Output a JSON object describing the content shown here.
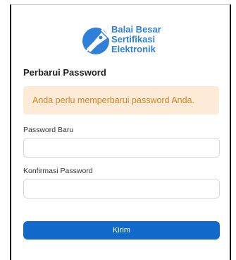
{
  "brand": {
    "lines": [
      "Balai Besar",
      "Sertifikasi",
      "Elektronik"
    ],
    "color": "#2f80d9"
  },
  "form": {
    "title": "Perbarui Password",
    "alert": "Anda perlu memperbarui password Anda.",
    "new_password": {
      "label": "Password Baru",
      "value": "",
      "placeholder": ""
    },
    "confirm_password": {
      "label": "Konfirmasi Password",
      "value": "",
      "placeholder": ""
    },
    "submit_label": "Kirim"
  },
  "colors": {
    "alert_bg": "#fdebd7",
    "alert_text": "#d98324",
    "button": "#1269cc"
  },
  "icons": {
    "logo": "pen-nib-seal-icon"
  }
}
